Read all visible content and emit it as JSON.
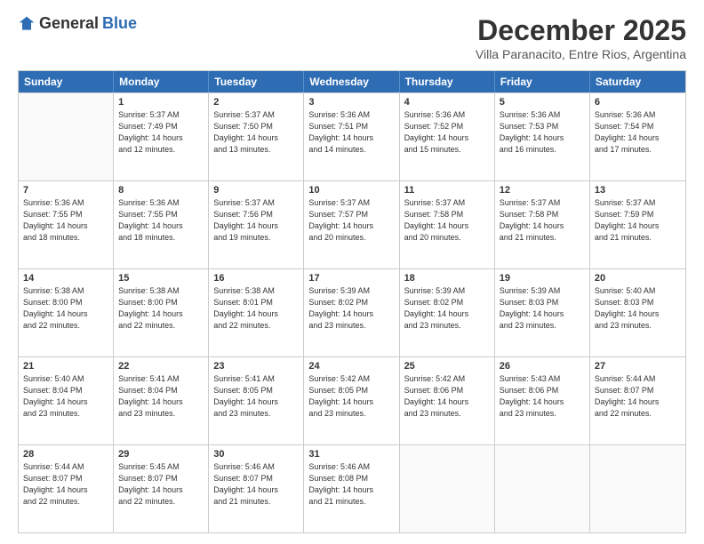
{
  "header": {
    "logo_general": "General",
    "logo_blue": "Blue",
    "month": "December 2025",
    "location": "Villa Paranacito, Entre Rios, Argentina"
  },
  "weekdays": [
    "Sunday",
    "Monday",
    "Tuesday",
    "Wednesday",
    "Thursday",
    "Friday",
    "Saturday"
  ],
  "weeks": [
    [
      {
        "day": "",
        "info": ""
      },
      {
        "day": "1",
        "info": "Sunrise: 5:37 AM\nSunset: 7:49 PM\nDaylight: 14 hours\nand 12 minutes."
      },
      {
        "day": "2",
        "info": "Sunrise: 5:37 AM\nSunset: 7:50 PM\nDaylight: 14 hours\nand 13 minutes."
      },
      {
        "day": "3",
        "info": "Sunrise: 5:36 AM\nSunset: 7:51 PM\nDaylight: 14 hours\nand 14 minutes."
      },
      {
        "day": "4",
        "info": "Sunrise: 5:36 AM\nSunset: 7:52 PM\nDaylight: 14 hours\nand 15 minutes."
      },
      {
        "day": "5",
        "info": "Sunrise: 5:36 AM\nSunset: 7:53 PM\nDaylight: 14 hours\nand 16 minutes."
      },
      {
        "day": "6",
        "info": "Sunrise: 5:36 AM\nSunset: 7:54 PM\nDaylight: 14 hours\nand 17 minutes."
      }
    ],
    [
      {
        "day": "7",
        "info": "Sunrise: 5:36 AM\nSunset: 7:55 PM\nDaylight: 14 hours\nand 18 minutes."
      },
      {
        "day": "8",
        "info": "Sunrise: 5:36 AM\nSunset: 7:55 PM\nDaylight: 14 hours\nand 18 minutes."
      },
      {
        "day": "9",
        "info": "Sunrise: 5:37 AM\nSunset: 7:56 PM\nDaylight: 14 hours\nand 19 minutes."
      },
      {
        "day": "10",
        "info": "Sunrise: 5:37 AM\nSunset: 7:57 PM\nDaylight: 14 hours\nand 20 minutes."
      },
      {
        "day": "11",
        "info": "Sunrise: 5:37 AM\nSunset: 7:58 PM\nDaylight: 14 hours\nand 20 minutes."
      },
      {
        "day": "12",
        "info": "Sunrise: 5:37 AM\nSunset: 7:58 PM\nDaylight: 14 hours\nand 21 minutes."
      },
      {
        "day": "13",
        "info": "Sunrise: 5:37 AM\nSunset: 7:59 PM\nDaylight: 14 hours\nand 21 minutes."
      }
    ],
    [
      {
        "day": "14",
        "info": "Sunrise: 5:38 AM\nSunset: 8:00 PM\nDaylight: 14 hours\nand 22 minutes."
      },
      {
        "day": "15",
        "info": "Sunrise: 5:38 AM\nSunset: 8:00 PM\nDaylight: 14 hours\nand 22 minutes."
      },
      {
        "day": "16",
        "info": "Sunrise: 5:38 AM\nSunset: 8:01 PM\nDaylight: 14 hours\nand 22 minutes."
      },
      {
        "day": "17",
        "info": "Sunrise: 5:39 AM\nSunset: 8:02 PM\nDaylight: 14 hours\nand 23 minutes."
      },
      {
        "day": "18",
        "info": "Sunrise: 5:39 AM\nSunset: 8:02 PM\nDaylight: 14 hours\nand 23 minutes."
      },
      {
        "day": "19",
        "info": "Sunrise: 5:39 AM\nSunset: 8:03 PM\nDaylight: 14 hours\nand 23 minutes."
      },
      {
        "day": "20",
        "info": "Sunrise: 5:40 AM\nSunset: 8:03 PM\nDaylight: 14 hours\nand 23 minutes."
      }
    ],
    [
      {
        "day": "21",
        "info": "Sunrise: 5:40 AM\nSunset: 8:04 PM\nDaylight: 14 hours\nand 23 minutes."
      },
      {
        "day": "22",
        "info": "Sunrise: 5:41 AM\nSunset: 8:04 PM\nDaylight: 14 hours\nand 23 minutes."
      },
      {
        "day": "23",
        "info": "Sunrise: 5:41 AM\nSunset: 8:05 PM\nDaylight: 14 hours\nand 23 minutes."
      },
      {
        "day": "24",
        "info": "Sunrise: 5:42 AM\nSunset: 8:05 PM\nDaylight: 14 hours\nand 23 minutes."
      },
      {
        "day": "25",
        "info": "Sunrise: 5:42 AM\nSunset: 8:06 PM\nDaylight: 14 hours\nand 23 minutes."
      },
      {
        "day": "26",
        "info": "Sunrise: 5:43 AM\nSunset: 8:06 PM\nDaylight: 14 hours\nand 23 minutes."
      },
      {
        "day": "27",
        "info": "Sunrise: 5:44 AM\nSunset: 8:07 PM\nDaylight: 14 hours\nand 22 minutes."
      }
    ],
    [
      {
        "day": "28",
        "info": "Sunrise: 5:44 AM\nSunset: 8:07 PM\nDaylight: 14 hours\nand 22 minutes."
      },
      {
        "day": "29",
        "info": "Sunrise: 5:45 AM\nSunset: 8:07 PM\nDaylight: 14 hours\nand 22 minutes."
      },
      {
        "day": "30",
        "info": "Sunrise: 5:46 AM\nSunset: 8:07 PM\nDaylight: 14 hours\nand 21 minutes."
      },
      {
        "day": "31",
        "info": "Sunrise: 5:46 AM\nSunset: 8:08 PM\nDaylight: 14 hours\nand 21 minutes."
      },
      {
        "day": "",
        "info": ""
      },
      {
        "day": "",
        "info": ""
      },
      {
        "day": "",
        "info": ""
      }
    ]
  ]
}
